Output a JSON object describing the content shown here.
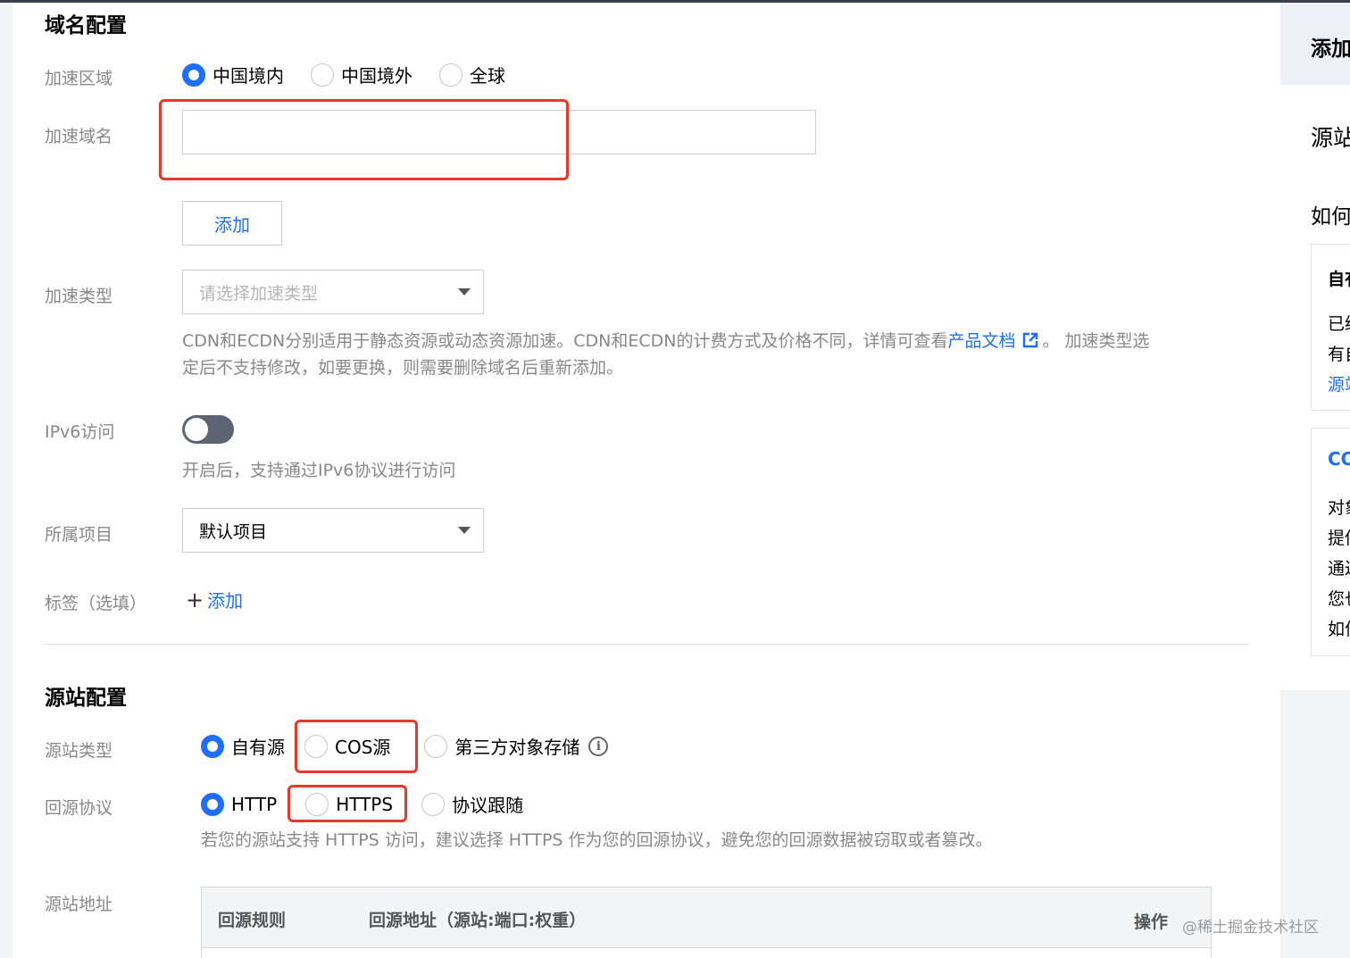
{
  "domain_config": {
    "title": "域名配置",
    "region": {
      "label": "加速区域",
      "options": [
        "中国境内",
        "中国境外",
        "全球"
      ],
      "selected": "中国境内"
    },
    "domain": {
      "label": "加速域名",
      "value": "",
      "add_button": "添加"
    },
    "type": {
      "label": "加速类型",
      "placeholder": "请选择加速类型",
      "help_prefix": "CDN和ECDN分别适用于静态资源或动态资源加速。CDN和ECDN的计费方式及价格不同，详情可查看",
      "help_link": "产品文档",
      "help_suffix": "。 加速类型选",
      "help_line2": "定后不支持修改，如要更换，则需要删除域名后重新添加。"
    },
    "ipv6": {
      "label": "IPv6访问",
      "enabled": false,
      "help": "开启后，支持通过IPv6协议进行访问"
    },
    "project": {
      "label": "所属项目",
      "value": "默认项目"
    },
    "tags": {
      "label": "标签（选填）",
      "add_link": "添加"
    }
  },
  "origin_config": {
    "title": "源站配置",
    "origin_type": {
      "label": "源站类型",
      "options": [
        "自有源",
        "COS源",
        "第三方对象存储"
      ],
      "selected": "自有源"
    },
    "protocol": {
      "label": "回源协议",
      "options": [
        "HTTP",
        "HTTPS",
        "协议跟随"
      ],
      "selected": "HTTP",
      "help": "若您的源站支持 HTTPS 访问，建议选择 HTTPS 作为您的回源协议，避免您的回源数据被窃取或者篡改。"
    },
    "address": {
      "label": "源站地址",
      "columns": [
        "回源规则",
        "回源地址（源站:端口:权重）",
        "操作"
      ]
    }
  },
  "side_panel": {
    "title_fragment": "添加",
    "items": [
      "源站",
      "如何"
    ],
    "card1": [
      "自有",
      "已经",
      "有自",
      "源站"
    ],
    "card2": [
      "CO",
      "对象",
      "提供",
      "通过",
      "您也",
      "如何"
    ]
  },
  "watermark": "@稀土掘金技术社区",
  "colors": {
    "accent": "#1e6fff",
    "highlight": "#e4392b"
  }
}
